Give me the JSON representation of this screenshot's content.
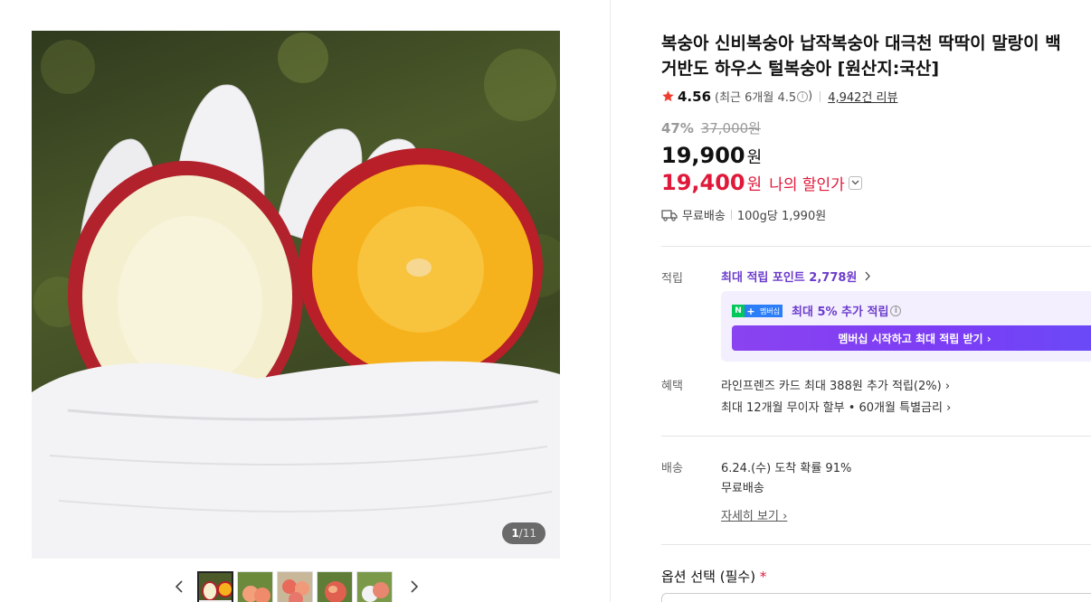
{
  "gallery": {
    "counter_current": "1",
    "counter_sep": "/",
    "counter_total": "11",
    "prev_icon": "chevron-left-icon",
    "next_icon": "chevron-right-icon"
  },
  "product": {
    "title": "복숭아 신비복숭아 납작복숭아 대극천 딱딱이 말랑이 백\n거반도 하우스 털복숭아 [원산지:국산]",
    "rating_score": "4.56",
    "rating_recent": "(최근 6개월 4.5",
    "rating_recent_close": ")",
    "review_count": "4,942건 리뷰",
    "discount_rate": "47%",
    "original_price": "37,000원",
    "price": "19,900",
    "price_unit": "원",
    "my_price": "19,400",
    "my_price_unit": "원",
    "my_price_label": "나의 할인가"
  },
  "shipping_summary": {
    "free": "무료배송",
    "unit_price": "100g당 1,990원"
  },
  "points": {
    "label": "적립",
    "max_point_link": "최대 적립 포인트 2,778원",
    "membership_badge_text": "멤버십",
    "membership_extra": "최대 5% 추가 적립",
    "membership_button": "멤버십 시작하고 최대 적립 받기"
  },
  "benefits": {
    "label": "혜택",
    "card": "라인프렌즈 카드 최대 388원 추가 적립(2%)",
    "installment": "최대 12개월 무이자 할부 • 60개월 특별금리"
  },
  "delivery": {
    "label": "배송",
    "arrival": "6.24.(수) 도착 확률 91%",
    "fee": "무료배송",
    "detail_link": "자세히 보기"
  },
  "option": {
    "label": "옵션 선택 (필수)",
    "required_mark": "*"
  },
  "colors": {
    "discount_red": "#e0193a",
    "star": "#f03c2e",
    "point_purple": "#6c3ccc",
    "naver_green": "#03c75a"
  }
}
